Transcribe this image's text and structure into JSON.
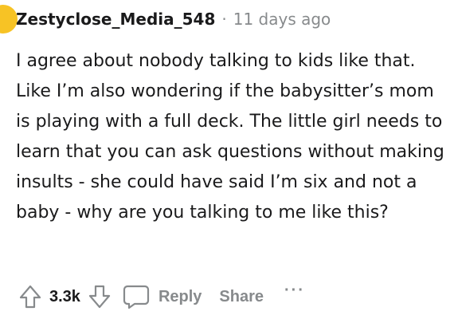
{
  "comment": {
    "username": "Zestyclose_Media_548",
    "separator": "·",
    "timestamp": "11 days ago",
    "body": "I agree about nobody talking to kids like that. Like I’m also wondering if the babysitter’s mom is playing with a full deck. The little girl needs to learn that you can ask questions without making insults - she could have said I’m six and not a baby - why are you talking to me like this?"
  },
  "actions": {
    "vote_count": "3.3k",
    "reply_label": "Reply",
    "share_label": "Share",
    "more_label": "···"
  },
  "icons": {
    "avatar": "avatar",
    "upvote": "upvote-arrow-icon",
    "downvote": "downvote-arrow-icon",
    "reply": "speech-bubble-icon",
    "more": "ellipsis-icon"
  },
  "colors": {
    "avatar": "#f7c325",
    "text": "#1a1a1b",
    "muted": "#878a8c"
  }
}
